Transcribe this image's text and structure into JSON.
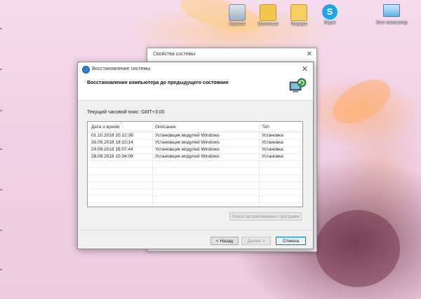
{
  "desktop": {
    "icons": [
      {
        "name": "recycle-bin-icon",
        "label": "Корзина"
      },
      {
        "name": "folder-icon",
        "label": "Молочные"
      },
      {
        "name": "folder-icon",
        "label": "Текущее"
      },
      {
        "name": "skype-icon",
        "label": "Skype"
      },
      {
        "name": "computer-icon",
        "label": "Этот компьютер"
      }
    ]
  },
  "background_window": {
    "title": "Свойства системы",
    "close": "✕"
  },
  "dialog": {
    "title": "Восстановление системы",
    "close": "✕",
    "heading": "Восстановление компьютера до предыдущего состояния",
    "timezone": "Текущий часовой пояс: GMT+3:00",
    "columns": [
      "Дата и время",
      "Описание",
      "Тип"
    ],
    "rows": [
      {
        "date": "01.10.2018 20:12:38",
        "desc": "Установщик модулей Windows",
        "type": "Установка"
      },
      {
        "date": "30.09.2018 18:10:14",
        "desc": "Установщик модулей Windows",
        "type": "Установка"
      },
      {
        "date": "29.09.2018 16:07:44",
        "desc": "Установщик модулей Windows",
        "type": "Установка"
      },
      {
        "date": "28.09.2018 15:34:08",
        "desc": "Установщик модулей Windows",
        "type": "Установка"
      }
    ],
    "search_button": "Поиск затрагиваемых программ",
    "back_button": "< Назад",
    "next_button": "Далее >",
    "cancel_button": "Отмена"
  }
}
